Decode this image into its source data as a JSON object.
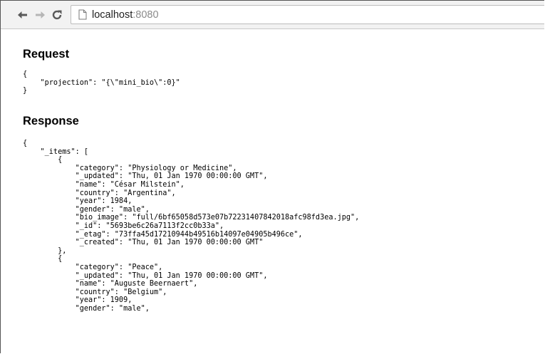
{
  "browser": {
    "url_host": "localhost",
    "url_port": ":8080",
    "icons": {
      "back": "arrow-left-icon",
      "forward": "arrow-right-icon",
      "reload": "reload-icon",
      "page": "page-icon"
    }
  },
  "request": {
    "heading": "Request",
    "body": "{\n    \"projection\": \"{\\\"mini_bio\\\":0}\"\n}"
  },
  "response": {
    "heading": "Response",
    "body": "{\n    \"_items\": [\n        {\n            \"category\": \"Physiology or Medicine\",\n            \"_updated\": \"Thu, 01 Jan 1970 00:00:00 GMT\",\n            \"name\": \"César Milstein\",\n            \"country\": \"Argentina\",\n            \"year\": 1984,\n            \"gender\": \"male\",\n            \"bio_image\": \"full/6bf65058d573e07b72231407842018afc98fd3ea.jpg\",\n            \"_id\": \"5693be6c26a7113f2cc0b33a\",\n            \"_etag\": \"73ffa45d17210944b49516b14097e04905b496ce\",\n            \"_created\": \"Thu, 01 Jan 1970 00:00:00 GMT\"\n        },\n        {\n            \"category\": \"Peace\",\n            \"_updated\": \"Thu, 01 Jan 1970 00:00:00 GMT\",\n            \"name\": \"Auguste Beernaert\",\n            \"country\": \"Belgium\",\n            \"year\": 1909,\n            \"gender\": \"male\","
  },
  "colors": {
    "toolbar_bg": "#f2f2f2",
    "nav_icon": "#5a5a5a",
    "nav_icon_disabled": "#b5b5b5",
    "port_text": "#8a8a8a"
  }
}
